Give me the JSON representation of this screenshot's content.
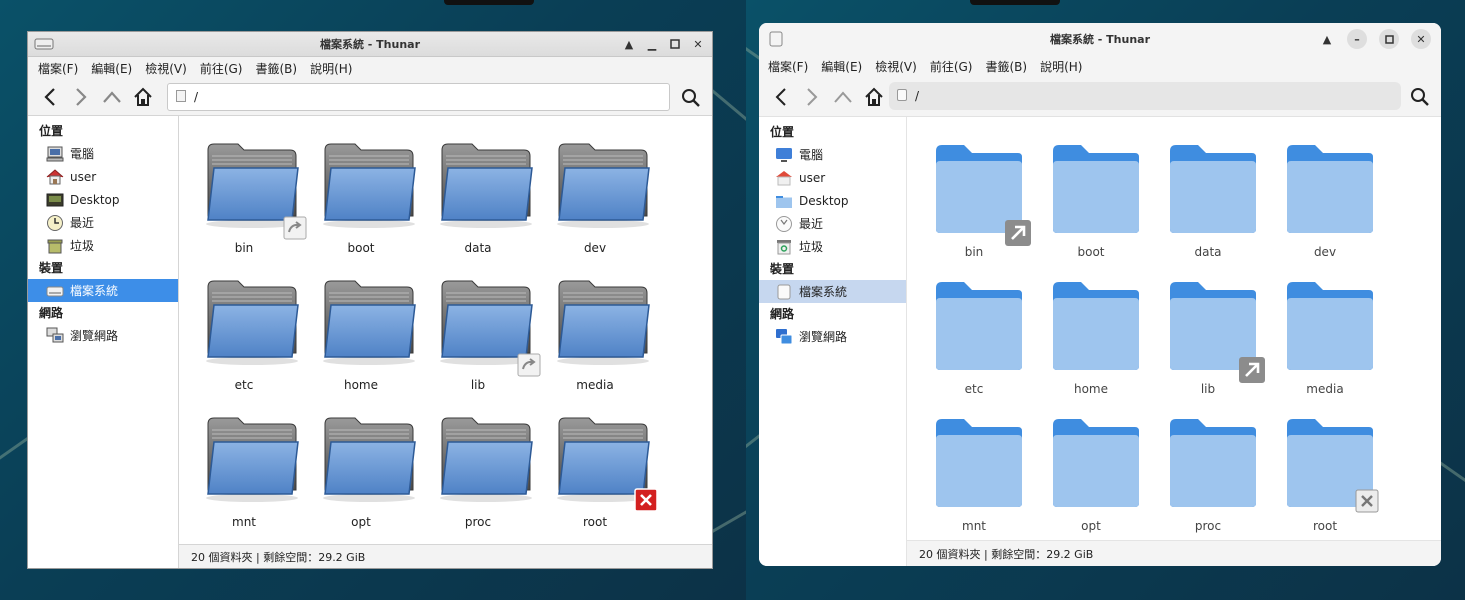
{
  "window_left": {
    "title": "檔案系統 - Thunar",
    "menu": [
      "檔案(F)",
      "編輯(E)",
      "檢視(V)",
      "前往(G)",
      "書籤(B)",
      "說明(H)"
    ],
    "address": "/",
    "sidebar": {
      "sections": [
        {
          "title": "位置",
          "items": [
            {
              "label": "電腦",
              "icon": "computer-icon"
            },
            {
              "label": "user",
              "icon": "home-icon"
            },
            {
              "label": "Desktop",
              "icon": "desktop-icon"
            },
            {
              "label": "最近",
              "icon": "recent-icon"
            },
            {
              "label": "垃圾",
              "icon": "trash-icon"
            }
          ]
        },
        {
          "title": "裝置",
          "items": [
            {
              "label": "檔案系統",
              "icon": "drive-icon",
              "active": true
            }
          ]
        },
        {
          "title": "網路",
          "items": [
            {
              "label": "瀏覽網路",
              "icon": "network-icon"
            }
          ]
        }
      ]
    },
    "folders": [
      {
        "name": "bin",
        "emblem": "symlink"
      },
      {
        "name": "boot"
      },
      {
        "name": "data"
      },
      {
        "name": "dev"
      },
      {
        "name": "etc"
      },
      {
        "name": "home"
      },
      {
        "name": "lib",
        "emblem": "symlink"
      },
      {
        "name": "media"
      },
      {
        "name": "mnt"
      },
      {
        "name": "opt"
      },
      {
        "name": "proc"
      },
      {
        "name": "root",
        "emblem": "unreadable"
      }
    ],
    "status": "20 個資料夾 | 剩餘空間：29.2 GiB"
  },
  "window_right": {
    "title": "檔案系統 - Thunar",
    "menu": [
      "檔案(F)",
      "編輯(E)",
      "檢視(V)",
      "前往(G)",
      "書籤(B)",
      "說明(H)"
    ],
    "address": "/",
    "sidebar": {
      "sections": [
        {
          "title": "位置",
          "items": [
            {
              "label": "電腦",
              "icon": "computer-icon"
            },
            {
              "label": "user",
              "icon": "home-icon"
            },
            {
              "label": "Desktop",
              "icon": "desktop-icon"
            },
            {
              "label": "最近",
              "icon": "recent-icon"
            },
            {
              "label": "垃圾",
              "icon": "trash-icon"
            }
          ]
        },
        {
          "title": "裝置",
          "items": [
            {
              "label": "檔案系統",
              "icon": "drive-icon",
              "active": true
            }
          ]
        },
        {
          "title": "網路",
          "items": [
            {
              "label": "瀏覽網路",
              "icon": "network-icon"
            }
          ]
        }
      ]
    },
    "folders": [
      {
        "name": "bin",
        "emblem": "symlink"
      },
      {
        "name": "boot"
      },
      {
        "name": "data"
      },
      {
        "name": "dev"
      },
      {
        "name": "etc"
      },
      {
        "name": "home"
      },
      {
        "name": "lib",
        "emblem": "symlink"
      },
      {
        "name": "media"
      },
      {
        "name": "mnt"
      },
      {
        "name": "opt"
      },
      {
        "name": "proc"
      },
      {
        "name": "root",
        "emblem": "unreadable"
      }
    ],
    "status": "20 個資料夾 | 剩餘空間：29.2 GiB"
  },
  "colors": {
    "desktop": "#0a4560",
    "selection_left": "#3d8ee8",
    "selection_right": "#c6d7ef",
    "folder_left": "#5b8fd0",
    "folder_right": "#9ec5ee",
    "folder_right_tab": "#3f8de0"
  }
}
